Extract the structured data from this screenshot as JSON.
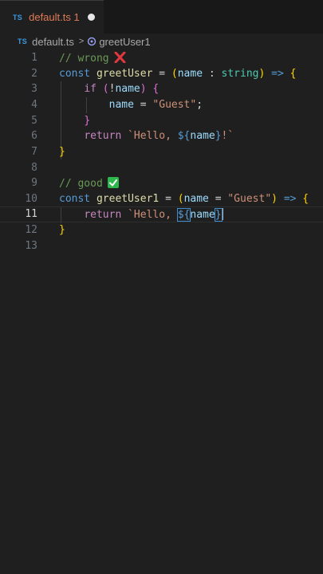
{
  "tab": {
    "badge": "TS",
    "label": "default.ts 1"
  },
  "breadcrumb": {
    "badge": "TS",
    "file": "default.ts",
    "sep": ">",
    "symbol": "greetUser1"
  },
  "editor": {
    "line_numbers": [
      "1",
      "2",
      "3",
      "4",
      "5",
      "6",
      "7",
      "8",
      "9",
      "10",
      "11",
      "12",
      "13"
    ],
    "active_line": "11",
    "lines": {
      "l1": {
        "comment": "// wrong"
      },
      "l2": {
        "kw": "const",
        "name": "greetUser",
        "eq": "=",
        "paren_open": "(",
        "param": "name",
        "colon": ":",
        "type": "string",
        "paren_close": ")",
        "arrow": "=>",
        "brace": "{"
      },
      "l3": {
        "kw": "if",
        "paren_open": "(",
        "not": "!",
        "var": "name",
        "paren_close": ")",
        "brace": "{"
      },
      "l4": {
        "var": "name",
        "eq": "=",
        "str": "\"Guest\"",
        "semi": ";"
      },
      "l5": {
        "brace": "}"
      },
      "l6": {
        "kw": "return",
        "tmpl_start": "`Hello, ",
        "interp_open": "${",
        "var": "name",
        "interp_close": "}",
        "tmpl_end": "!`"
      },
      "l7": {
        "brace": "}"
      },
      "l9": {
        "comment": "// good"
      },
      "l10": {
        "kw": "const",
        "name": "greetUser1",
        "eq": "=",
        "paren_open": "(",
        "param": "name",
        "eq2": "=",
        "str": "\"Guest\"",
        "paren_close": ")",
        "arrow": "=>",
        "brace": "{"
      },
      "l11": {
        "kw": "return",
        "tmpl_start": "`Hello, ",
        "interp_open": "${",
        "var": "name",
        "interp_close": "}"
      },
      "l12": {
        "brace": "}"
      }
    }
  }
}
